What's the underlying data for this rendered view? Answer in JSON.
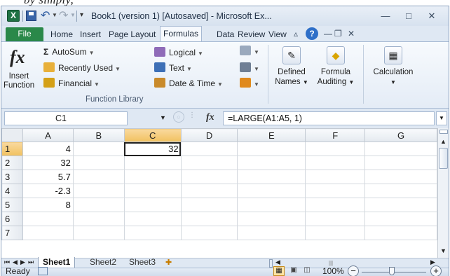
{
  "crop_text": "by simply,",
  "titlebar": {
    "app_icon": "excel-icon",
    "title": "Book1 (version 1) [Autosaved] - Microsoft Ex...",
    "minimize": "—",
    "maximize": "□",
    "close": "✕"
  },
  "tabs": [
    "File",
    "Home",
    "Insert",
    "Page Layout",
    "Formulas",
    "Data",
    "Review",
    "View"
  ],
  "ribbon": {
    "insert_function": "Insert Function",
    "autosum": "AutoSum",
    "recently_used": "Recently Used",
    "financial": "Financial",
    "logical": "Logical",
    "text": "Text",
    "date_time": "Date & Time",
    "group_label": "Function Library",
    "defined_names": "Defined Names",
    "formula_auditing": "Formula Auditing",
    "calculation": "Calculation"
  },
  "formula_bar": {
    "name_box": "C1",
    "fx": "fx",
    "formula": "=LARGE(A1:A5, 1)"
  },
  "grid": {
    "columns": [
      "A",
      "B",
      "C",
      "D",
      "E",
      "F",
      "G"
    ],
    "rows": [
      {
        "num": "1",
        "cells": [
          "4",
          "",
          "32",
          "",
          "",
          "",
          ""
        ]
      },
      {
        "num": "2",
        "cells": [
          "32",
          "",
          "",
          "",
          "",
          "",
          ""
        ]
      },
      {
        "num": "3",
        "cells": [
          "5.7",
          "",
          "",
          "",
          "",
          "",
          ""
        ]
      },
      {
        "num": "4",
        "cells": [
          "-2.3",
          "",
          "",
          "",
          "",
          "",
          ""
        ]
      },
      {
        "num": "5",
        "cells": [
          "8",
          "",
          "",
          "",
          "",
          "",
          ""
        ]
      },
      {
        "num": "6",
        "cells": [
          "",
          "",
          "",
          "",
          "",
          "",
          ""
        ]
      },
      {
        "num": "7",
        "cells": [
          "",
          "",
          "",
          "",
          "",
          "",
          ""
        ]
      }
    ],
    "active_cell": "C1"
  },
  "sheets": [
    "Sheet1",
    "Sheet2",
    "Sheet3"
  ],
  "status": {
    "ready": "Ready",
    "zoom": "100%"
  },
  "colors": {
    "file_tab": "#2a8849",
    "selection_header": "#f1c15f"
  }
}
